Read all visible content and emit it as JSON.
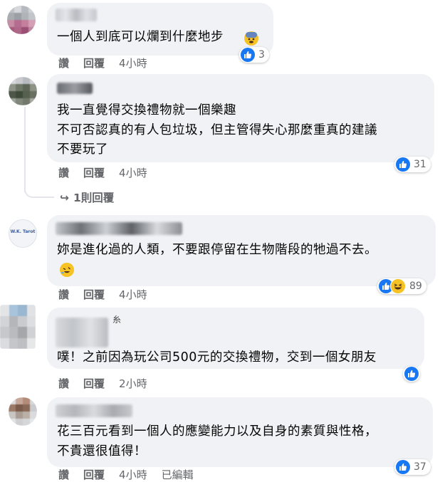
{
  "comments": [
    {
      "text_lines": [
        "一個人到底可以爛到什麼地步"
      ],
      "actions": {
        "like": "讚",
        "reply": "回覆",
        "time": "4小時"
      },
      "reaction_count": "3"
    },
    {
      "text_lines": [
        "我一直覺得交換禮物就一個樂趣",
        "不可否認真的有人包垃圾，但主管得失心那麼重真的建議",
        "不要玩了"
      ],
      "actions": {
        "like": "讚",
        "reply": "回覆",
        "time": "4小時"
      },
      "reaction_count": "31",
      "replies_link": "1則回覆"
    },
    {
      "text_lines": [
        "妳是進化過的人類，不要跟停留在生物階段的牠過不去。"
      ],
      "avatar_text": "W.K. Tarot",
      "actions": {
        "like": "讚",
        "reply": "回覆",
        "time": "4小時"
      },
      "reaction_count": "89"
    },
    {
      "text_lines": [
        "噗！之前因為玩公司500元的交換禮物，交到一個女朋友"
      ],
      "name_suffix": "糸",
      "actions": {
        "like": "讚",
        "reply": "回覆",
        "time": "2小時"
      },
      "reaction_count": ""
    },
    {
      "text_lines": [
        "花三百元看到一個人的應變能力以及自身的素質與性格，",
        "不貴還很值得！"
      ],
      "actions": {
        "like": "讚",
        "reply": "回覆",
        "time": "4小時",
        "edited": "已編輯"
      },
      "reaction_count": "37"
    }
  ],
  "colors": {
    "like_blue": "#1877f2",
    "bubble_bg": "#f0f2f5",
    "meta_gray": "#65676b",
    "haha_yellow": "#f7c324"
  },
  "icons": {
    "like": "thumbs-up-icon",
    "haha": "laughing-face-icon",
    "reply_arrow": "reply-arrow-icon"
  }
}
